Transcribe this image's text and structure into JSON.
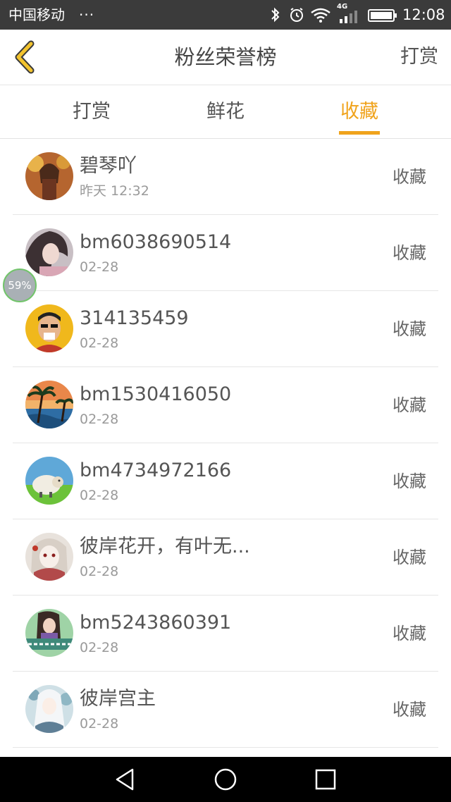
{
  "status_bar": {
    "carrier": "中国移动",
    "dots": "···",
    "network": "4G",
    "time": "12:08"
  },
  "header": {
    "title": "粉丝荣誉榜",
    "right_action": "打赏",
    "back_icon": "chevron-left-icon"
  },
  "tabs": [
    {
      "label": "打赏",
      "active": false
    },
    {
      "label": "鲜花",
      "active": false
    },
    {
      "label": "收藏",
      "active": true
    }
  ],
  "colors": {
    "accent": "#f0a31c",
    "status_bar_bg": "#3b3b3b",
    "nav_bar_bg": "#000000"
  },
  "fans": [
    {
      "name": "碧琴吖",
      "date": "昨天 12:32",
      "action": "收藏"
    },
    {
      "name": "bm6038690514",
      "date": "02-28",
      "action": "收藏"
    },
    {
      "name": "314135459",
      "date": "02-28",
      "action": "收藏"
    },
    {
      "name": "bm1530416050",
      "date": "02-28",
      "action": "收藏"
    },
    {
      "name": "bm4734972166",
      "date": "02-28",
      "action": "收藏"
    },
    {
      "name": "彼岸花开，有叶无...",
      "date": "02-28",
      "action": "收藏"
    },
    {
      "name": "bm5243860391",
      "date": "02-28",
      "action": "收藏"
    },
    {
      "name": "彼岸宫主",
      "date": "02-28",
      "action": "收藏"
    }
  ],
  "floating_badge": "59%",
  "nav_bar": {
    "back": "triangle-back-icon",
    "home": "circle-home-icon",
    "recents": "square-recents-icon"
  }
}
